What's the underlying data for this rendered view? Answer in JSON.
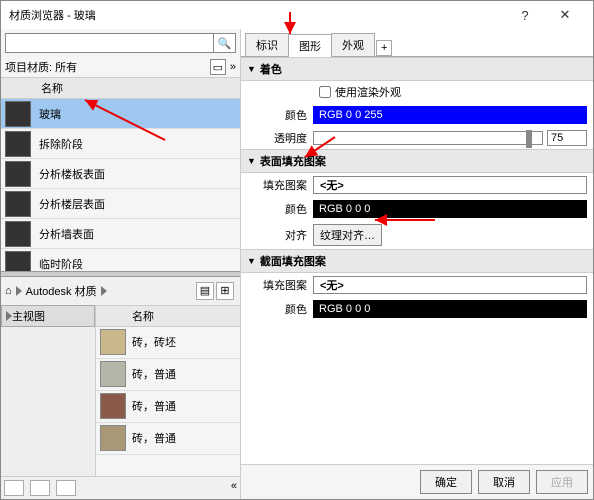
{
  "title": "材质浏览器 - 玻璃",
  "search": {
    "placeholder": ""
  },
  "filter": {
    "label": "项目材质: 所有",
    "expand": "»"
  },
  "listhdr": "名称",
  "materials": [
    {
      "name": "玻璃",
      "sel": true
    },
    {
      "name": "拆除阶段",
      "sel": false
    },
    {
      "name": "分析楼板表面",
      "sel": false
    },
    {
      "name": "分析楼层表面",
      "sel": false
    },
    {
      "name": "分析墙表面",
      "sel": false
    },
    {
      "name": "临时阶段",
      "sel": false
    }
  ],
  "bc": {
    "home": "⌂",
    "lib": "Autodesk 材质"
  },
  "treehdr": "主视图",
  "libhdr": "名称",
  "lib": [
    {
      "name": "砖，砖坯",
      "c": "#c9b88a"
    },
    {
      "name": "砖，普通",
      "c": "#b5b5a8"
    },
    {
      "name": "砖，普通",
      "c": "#8a5a4a"
    },
    {
      "name": "砖，普通",
      "c": "#a89878"
    }
  ],
  "tabs": {
    "t1": "标识",
    "t2": "图形",
    "t3": "外观"
  },
  "sect": {
    "shade": "着色",
    "surf": "表面填充图案",
    "cut": "截面填充图案"
  },
  "lbl": {
    "useRender": "使用渲染外观",
    "color": "颜色",
    "trans": "透明度",
    "pattern": "填充图案",
    "align": "对齐"
  },
  "val": {
    "rgbBlue": "RGB 0 0 255",
    "trans": "75",
    "none": "<无>",
    "rgbBlack": "RGB 0 0 0",
    "align": "纹理对齐…"
  },
  "btn": {
    "ok": "确定",
    "cancel": "取消",
    "apply": "应用"
  }
}
